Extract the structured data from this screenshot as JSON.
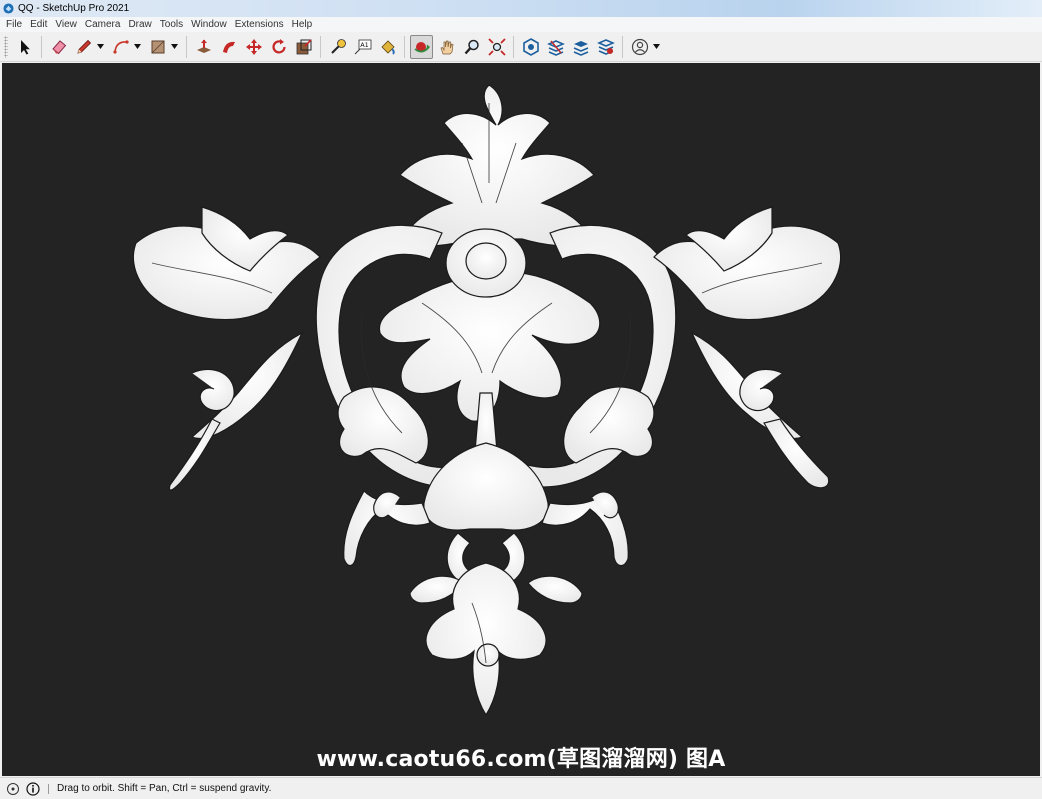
{
  "window": {
    "title": "QQ - SketchUp Pro 2021"
  },
  "menu": [
    "File",
    "Edit",
    "View",
    "Camera",
    "Draw",
    "Tools",
    "Window",
    "Extensions",
    "Help"
  ],
  "toolbar": {
    "tools": [
      {
        "name": "select-tool",
        "icon": "arrow-cursor-icon"
      },
      {
        "name": "eraser-tool",
        "icon": "eraser-icon"
      },
      {
        "name": "line-tool",
        "icon": "pencil-icon"
      },
      {
        "name": "arc-tool",
        "icon": "arc-icon"
      },
      {
        "name": "rectangle-tool",
        "icon": "rectangle-icon"
      },
      {
        "name": "push-pull-tool",
        "icon": "push-pull-icon"
      },
      {
        "name": "follow-me-tool",
        "icon": "follow-me-icon"
      },
      {
        "name": "move-tool",
        "icon": "move-icon"
      },
      {
        "name": "rotate-tool",
        "icon": "rotate-icon"
      },
      {
        "name": "scale-tool",
        "icon": "scale-icon"
      },
      {
        "name": "tape-measure-tool",
        "icon": "tape-measure-icon"
      },
      {
        "name": "text-tool",
        "icon": "text-icon"
      },
      {
        "name": "paint-bucket-tool",
        "icon": "paint-bucket-icon"
      },
      {
        "name": "orbit-tool",
        "icon": "orbit-icon",
        "active": true
      },
      {
        "name": "pan-tool",
        "icon": "hand-icon"
      },
      {
        "name": "zoom-tool",
        "icon": "magnifier-icon"
      },
      {
        "name": "zoom-extents-tool",
        "icon": "zoom-extents-icon"
      },
      {
        "name": "3d-warehouse",
        "icon": "warehouse-icon"
      },
      {
        "name": "extension-warehouse",
        "icon": "extension-warehouse-icon"
      },
      {
        "name": "layout-send",
        "icon": "layout-icon"
      },
      {
        "name": "extension-manager",
        "icon": "extension-manager-icon"
      },
      {
        "name": "account",
        "icon": "user-icon"
      }
    ],
    "text_tool_label": "A1"
  },
  "viewport": {
    "background": "#232323",
    "watermark": "www.caotu66.com(草图溜溜网) 图A"
  },
  "statusbar": {
    "message": "Drag to orbit. Shift = Pan, Ctrl = suspend gravity."
  }
}
